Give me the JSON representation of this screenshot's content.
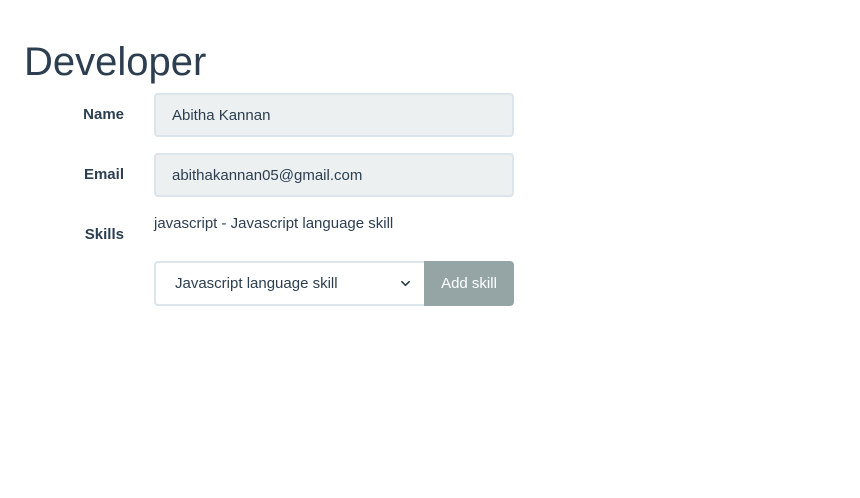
{
  "page": {
    "title": "Developer"
  },
  "form": {
    "name_label": "Name",
    "name_value": "Abitha Kannan",
    "email_label": "Email",
    "email_value": "abithakannan05@gmail.com",
    "skills_label": "Skills",
    "skills": [
      {
        "text": "javascript - Javascript language skill"
      }
    ],
    "skill_select_value": "Javascript language skill",
    "add_skill_label": "Add skill"
  },
  "colors": {
    "text": "#2c3e50",
    "input_bg": "#ecf0f1",
    "input_border": "#dce4ec",
    "button_bg": "#95a5a6",
    "button_text": "#ffffff"
  },
  "icons": {
    "select_arrow": "chevron-down-icon"
  }
}
